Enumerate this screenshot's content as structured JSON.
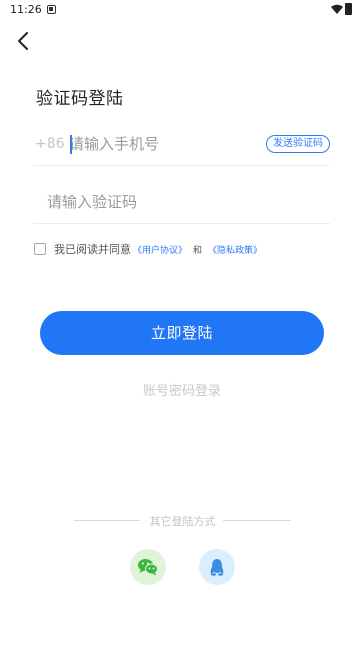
{
  "status_bar": {
    "time": "11:26"
  },
  "header": {
    "title": "验证码登陆"
  },
  "phone": {
    "country_code": "+86",
    "placeholder": "请输入手机号",
    "send_code_label": "发送验证码"
  },
  "code": {
    "placeholder": "请输入验证码"
  },
  "agreement": {
    "prefix": "我已阅读并同意",
    "user_agreement": "《用户协议》",
    "and": "和",
    "privacy_policy": "《隐私政策》"
  },
  "login_button": {
    "label": "立即登陆"
  },
  "password_login": {
    "label": "账号密码登录"
  },
  "other_login": {
    "label": "其它登陆方式"
  },
  "colors": {
    "accent": "#2176f5",
    "wechat": "#3cb83c",
    "qq": "#3a8ee6"
  }
}
